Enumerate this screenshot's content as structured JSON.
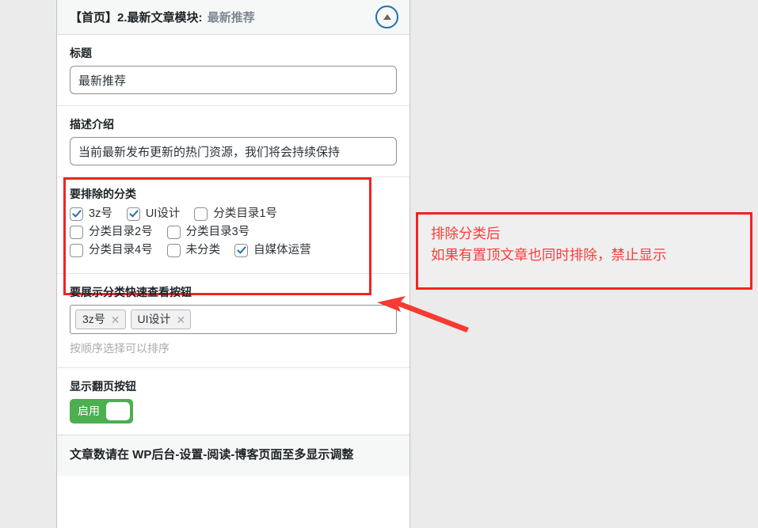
{
  "panel": {
    "header": {
      "title_main": "【首页】2.最新文章模块:",
      "title_sub": "最新推荐",
      "collapse_icon": "caret-up-icon"
    },
    "fields": {
      "title": {
        "label": "标题",
        "value": "最新推荐"
      },
      "description": {
        "label": "描述介绍",
        "value": "当前最新发布更新的热门资源，我们将会持续保持"
      },
      "exclude_categories": {
        "label": "要排除的分类",
        "options": [
          {
            "label": "3z号",
            "checked": true
          },
          {
            "label": "UI设计",
            "checked": true
          },
          {
            "label": "分类目录1号",
            "checked": false
          },
          {
            "label": "分类目录2号",
            "checked": false
          },
          {
            "label": "分类目录3号",
            "checked": false
          },
          {
            "label": "分类目录4号",
            "checked": false
          },
          {
            "label": "未分类",
            "checked": false
          },
          {
            "label": "自媒体运营",
            "checked": true
          }
        ]
      },
      "quick_view_categories": {
        "label": "要展示分类快速查看按钮",
        "chips": [
          "3z号",
          "UI设计"
        ],
        "remove_icon": "close-icon",
        "hint": "按顺序选择可以排序"
      },
      "show_pagination": {
        "label": "显示翻页按钮",
        "toggle_text": "启用",
        "enabled": true
      }
    },
    "footer_note": "文章数请在 WP后台-设置-阅读-博客页面至多显示调整"
  },
  "annotation": {
    "line1": "排除分类后",
    "line2": "如果有置顶文章也同时排除，禁止显示",
    "arrow_icon": "arrow-pointer-icon"
  },
  "colors": {
    "accent_blue": "#2271b1",
    "annotation_red": "#fb3b3b",
    "highlight_border": "#f42222",
    "toggle_green": "#4caf50"
  }
}
